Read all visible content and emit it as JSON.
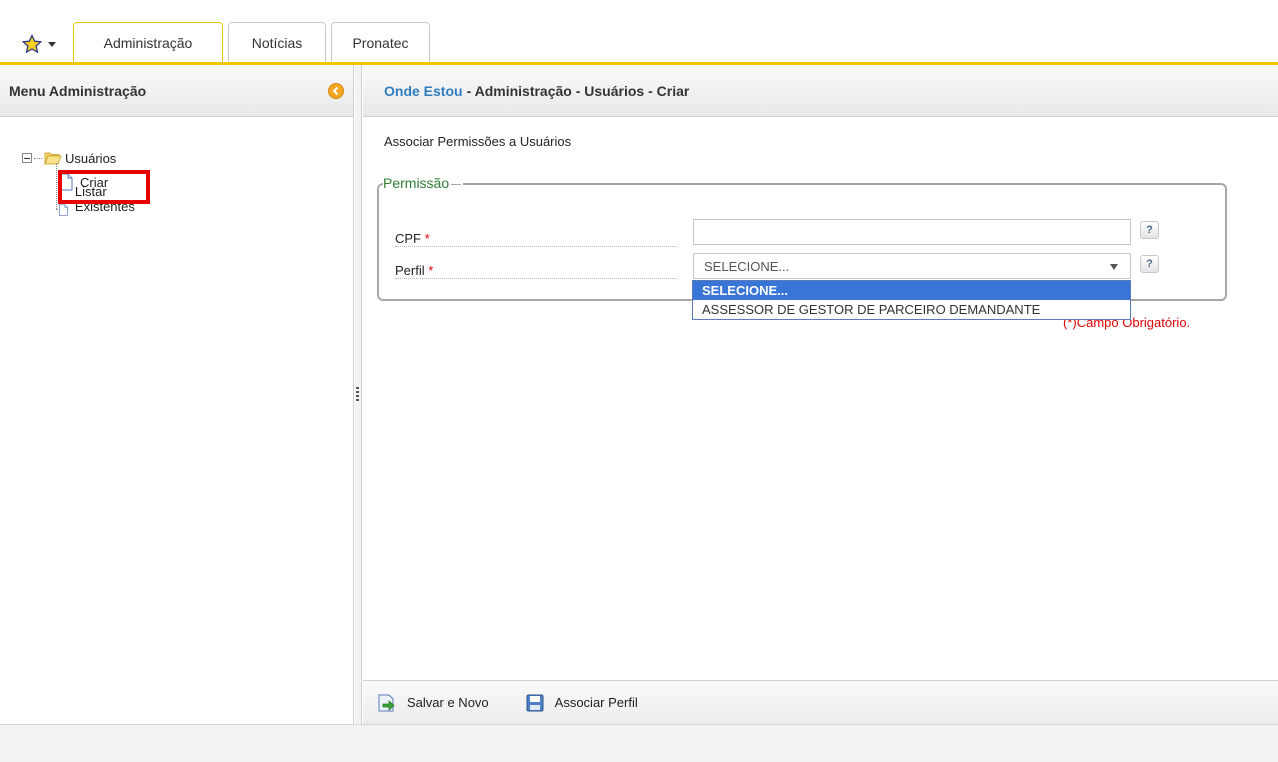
{
  "tabs": [
    {
      "label": "Administração",
      "active": true
    },
    {
      "label": "Notícias",
      "active": false
    },
    {
      "label": "Pronatec",
      "active": false
    }
  ],
  "favorites": {
    "icon": "star-icon"
  },
  "left_panel": {
    "title": "Menu Administração",
    "tree": {
      "root_label": "Usuários",
      "children": [
        {
          "label": "Criar"
        },
        {
          "label": "Listar Existentes"
        }
      ]
    }
  },
  "main": {
    "breadcrumb": {
      "link": "Onde Estou",
      "rest": "- Administração - Usuários - Criar"
    },
    "subtitle": "Associar Permissões a Usuários",
    "fieldset_legend": "Permissão",
    "fields": {
      "cpf_label": "CPF",
      "perfil_label": "Perfil",
      "required_mark": "*",
      "cpf_value": "",
      "perfil_selected": "SELECIONE..."
    },
    "help_text": "?",
    "dropdown_options": [
      "SELECIONE...",
      "ASSESSOR DE GESTOR DE PARCEIRO DEMANDANTE"
    ],
    "required_note": "(*)Campo Obrigatório."
  },
  "toolbar": {
    "save_new_label": "Salvar e Novo",
    "assoc_label": "Associar Perfil"
  },
  "colors": {
    "accent": "#f0c800",
    "link": "#2f7cc0",
    "legend": "#2e7d32",
    "required": "#e00000",
    "selected_option": "#3875d7"
  }
}
